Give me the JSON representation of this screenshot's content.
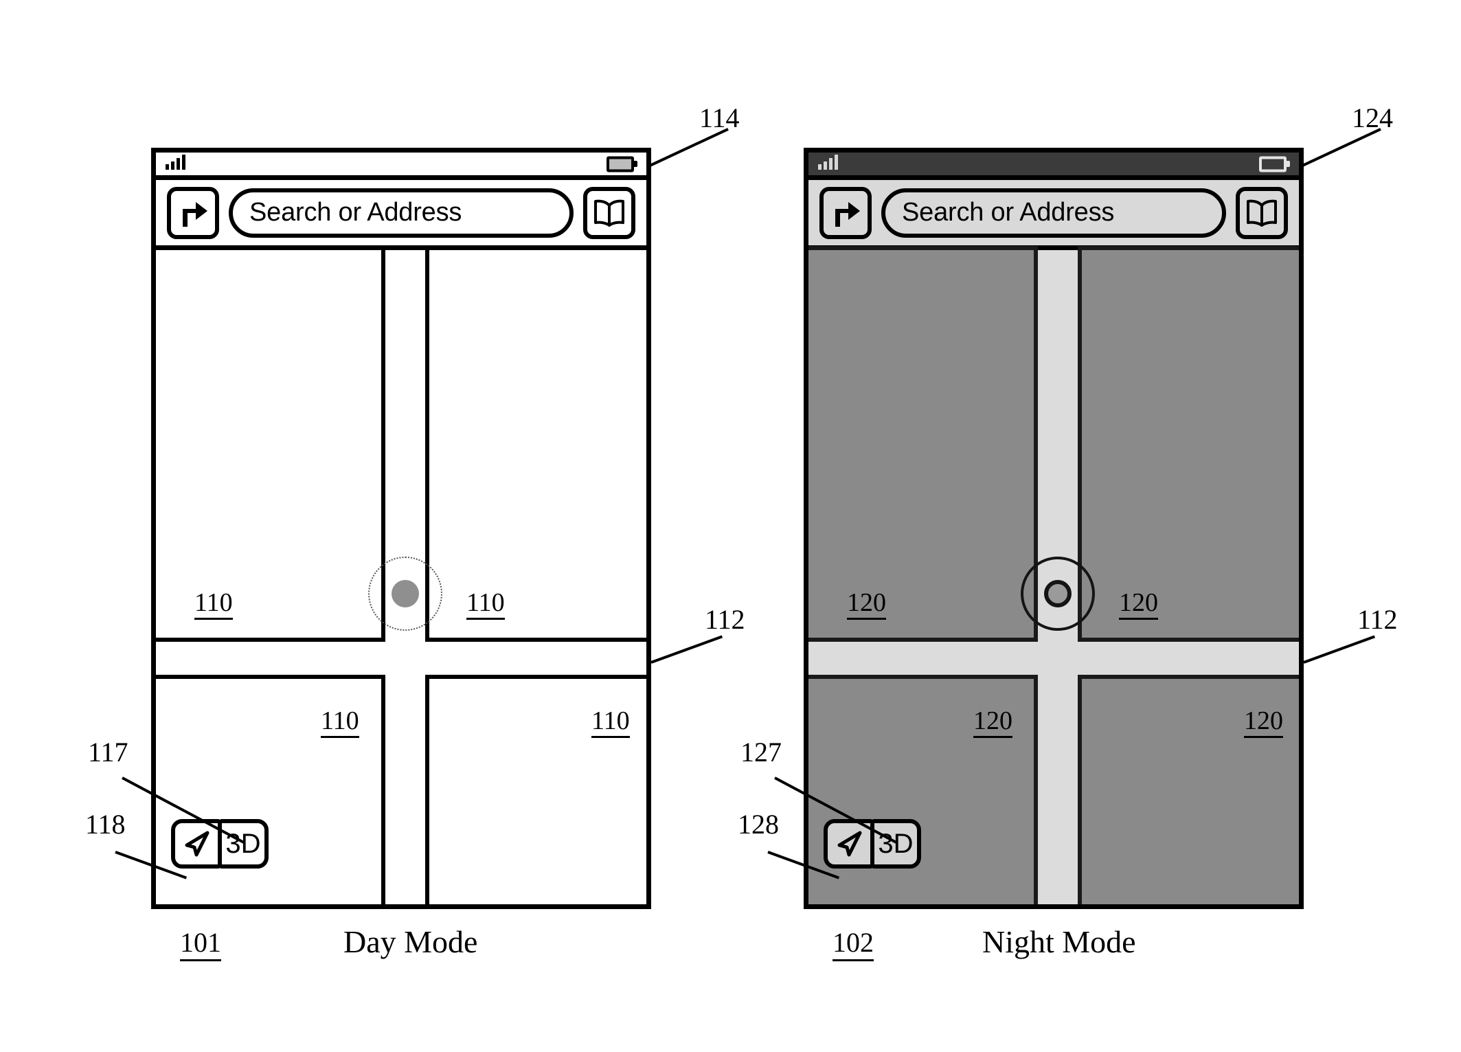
{
  "figure": {
    "panels": [
      {
        "id": "day",
        "ref": "101",
        "caption": "Day Mode",
        "status_bar": {
          "signal_icon": "signal-bars-icon",
          "battery_icon": "battery-icon",
          "ref": "114"
        },
        "toolbar": {
          "directions_icon": "directions-turn-right-icon",
          "search": {
            "placeholder": "Search or Address"
          },
          "bookmarks_icon": "book-bookmarks-icon"
        },
        "map": {
          "block_labels": [
            "110",
            "110",
            "110",
            "110"
          ],
          "road_ref": "112",
          "location_icon": "current-location-puck-icon"
        },
        "controls": {
          "tracking_icon": "navigation-arrow-icon",
          "tracking_ref": "118",
          "three_d_label": "3D",
          "three_d_ref": "117"
        }
      },
      {
        "id": "night",
        "ref": "102",
        "caption": "Night Mode",
        "status_bar": {
          "signal_icon": "signal-bars-icon",
          "battery_icon": "battery-icon",
          "ref": "124"
        },
        "toolbar": {
          "directions_icon": "directions-turn-right-icon",
          "search": {
            "placeholder": "Search or Address"
          },
          "bookmarks_icon": "book-bookmarks-icon"
        },
        "map": {
          "block_labels": [
            "120",
            "120",
            "120",
            "120"
          ],
          "road_ref": "112",
          "location_icon": "current-location-puck-icon"
        },
        "controls": {
          "tracking_icon": "navigation-arrow-icon",
          "tracking_ref": "128",
          "three_d_label": "3D",
          "three_d_ref": "127"
        }
      }
    ]
  },
  "colors": {
    "ink": "#000000",
    "day_block_fill": "#ffffff",
    "day_road_fill": "#ffffff",
    "night_block_fill": "#8a8a8a",
    "night_road_fill": "#dcdcdc",
    "night_toolbar_fill": "#d9d9d9",
    "night_statusbar_fill": "#3b3b3b",
    "location_dot_fill": "#8f8f8f"
  }
}
